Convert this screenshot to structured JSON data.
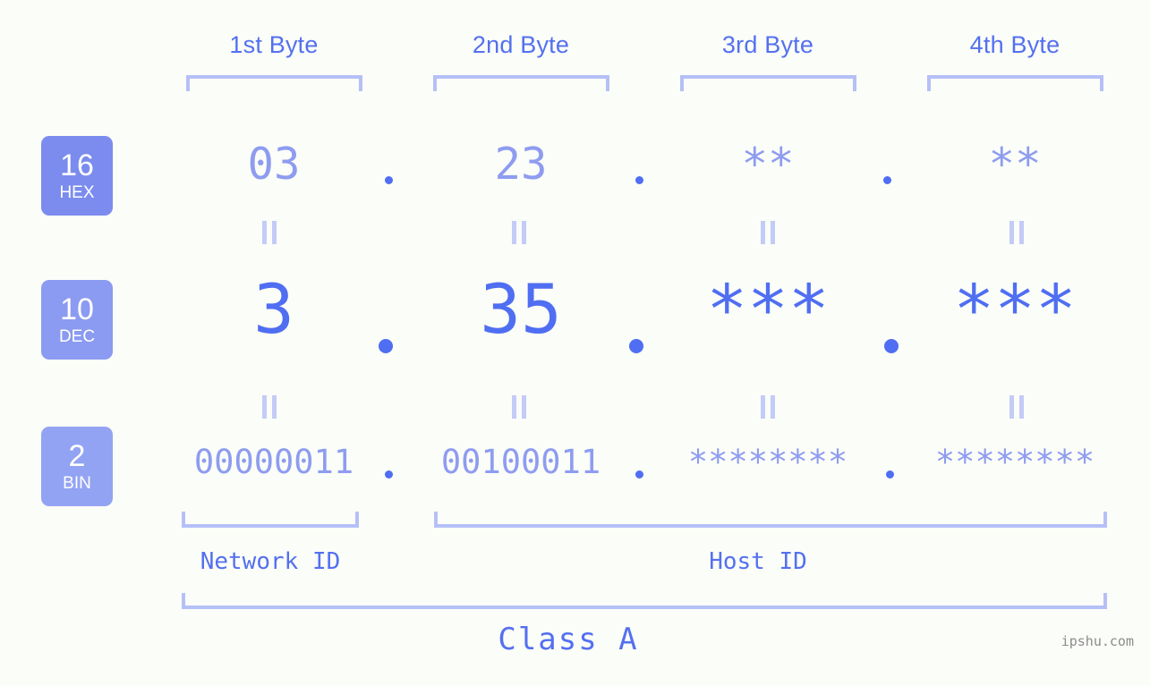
{
  "background_color": "#fbfdf8",
  "accent_color": "#4f6ef2",
  "accent_light_color": "#8e9cf0",
  "bracket_color": "#b5c0f7",
  "byte_headers": [
    {
      "label": "1st Byte"
    },
    {
      "label": "2nd Byte"
    },
    {
      "label": "3rd Byte"
    },
    {
      "label": "4th Byte"
    }
  ],
  "bases": [
    {
      "number": "16",
      "name": "HEX",
      "color": "#7b8cee"
    },
    {
      "number": "10",
      "name": "DEC",
      "color": "#8b9bf1"
    },
    {
      "number": "2",
      "name": "BIN",
      "color": "#93a3f3"
    }
  ],
  "rows": {
    "hex": {
      "base": "16",
      "base_name": "HEX",
      "bytes": [
        "03",
        "23",
        "**",
        "**"
      ],
      "separator": "."
    },
    "dec": {
      "base": "10",
      "base_name": "DEC",
      "bytes": [
        "3",
        "35",
        "***",
        "***"
      ],
      "separator": "."
    },
    "bin": {
      "base": "2",
      "base_name": "BIN",
      "bytes": [
        "00000011",
        "00100011",
        "********",
        "********"
      ],
      "separator": "."
    }
  },
  "equals_glyph": "=",
  "sections": [
    {
      "label": "Network ID"
    },
    {
      "label": "Host ID"
    }
  ],
  "class_label": "Class A",
  "watermark": "ipshu.com"
}
